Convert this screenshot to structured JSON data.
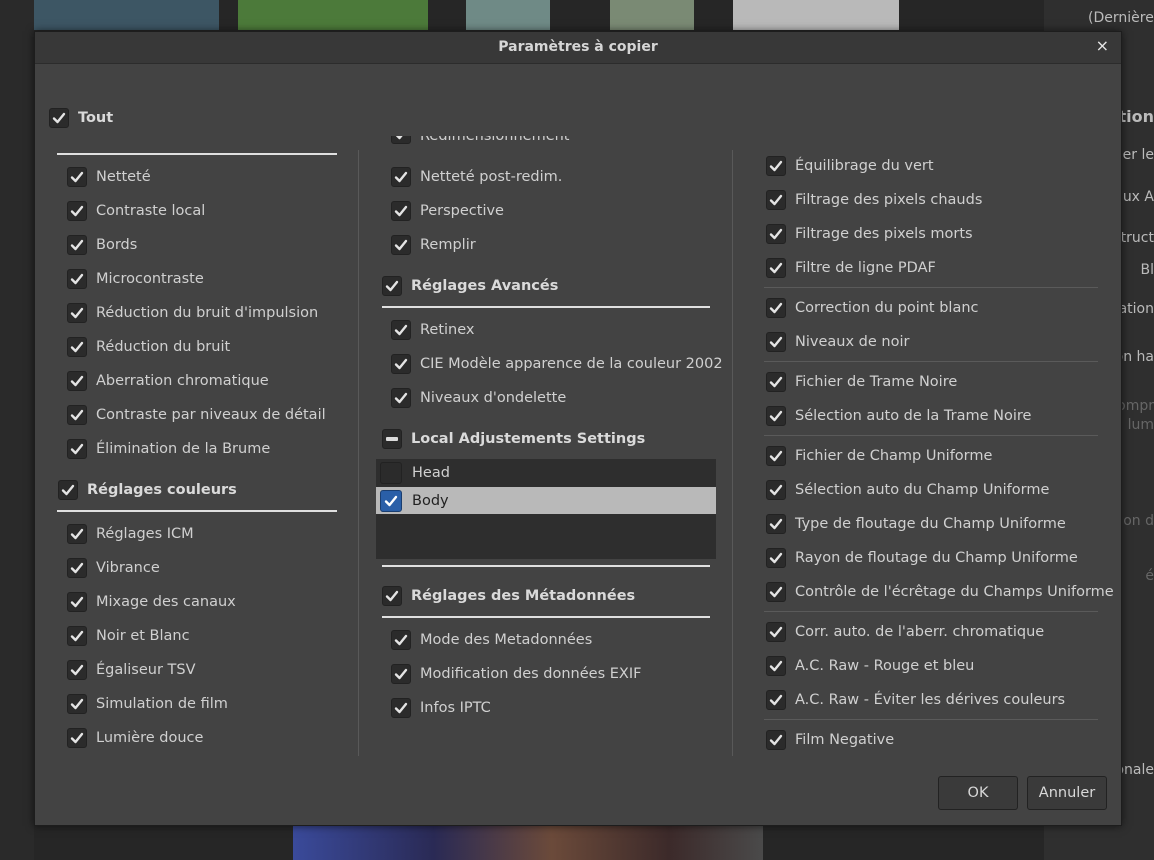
{
  "background": {
    "right_panel": [
      "(Dernière",
      "sition",
      "uer le",
      "aux A",
      "struct",
      "Bl",
      "ation",
      "ion ha",
      "ompr",
      "lum",
      "on d",
      "é",
      "onale"
    ]
  },
  "dialog": {
    "title": "Paramètres à copier",
    "close_label": "×",
    "ok_label": "OK",
    "cancel_label": "Annuler",
    "all_label": "Tout",
    "col1": {
      "top_items": [
        "Netteté",
        "Contraste local",
        "Bords",
        "Microcontraste",
        "Réduction du bruit d'impulsion",
        "Réduction du bruit",
        "Aberration chromatique",
        "Contraste par niveaux de détail",
        "Élimination de la Brume"
      ],
      "color_header": "Réglages couleurs",
      "color_items": [
        "Réglages ICM",
        "Vibrance",
        "Mixage des canaux",
        "Noir et Blanc",
        "Égaliseur TSV",
        "Simulation de film",
        "Lumière douce"
      ]
    },
    "col2": {
      "clipped_item": "Redimensionnement",
      "top_items": [
        "Netteté post-redim.",
        "Perspective",
        "Remplir"
      ],
      "advanced_header": "Réglages Avancés",
      "advanced_items": [
        "Retinex",
        "CIE Modèle apparence de la couleur 2002",
        "Niveaux d'ondelette"
      ],
      "local_header": "Local Adjustements Settings",
      "local_list": [
        {
          "label": "Head",
          "checked": false
        },
        {
          "label": "Body",
          "checked": true
        }
      ],
      "meta_header": "Réglages des Métadonnées",
      "meta_items": [
        "Mode des Metadonnées",
        "Modification des données EXIF",
        "Infos IPTC"
      ]
    },
    "col3": {
      "group1": [
        "Équilibrage du vert",
        "Filtrage des pixels chauds",
        "Filtrage des pixels morts",
        "Filtre de ligne PDAF"
      ],
      "group2": [
        "Correction du point blanc",
        "Niveaux de noir"
      ],
      "group3": [
        "Fichier de Trame Noire",
        "Sélection auto de la Trame Noire"
      ],
      "group4": [
        "Fichier de Champ Uniforme",
        "Sélection auto du Champ Uniforme",
        "Type de floutage du Champ Uniforme",
        "Rayon de floutage du Champ Uniforme",
        "Contrôle de l'écrêtage du Champs Uniforme"
      ],
      "group5": [
        "Corr. auto. de l'aberr. chromatique",
        "A.C. Raw - Rouge et bleu",
        "A.C. Raw - Éviter les dérives couleurs"
      ],
      "group6": [
        "Film Negative"
      ]
    }
  }
}
